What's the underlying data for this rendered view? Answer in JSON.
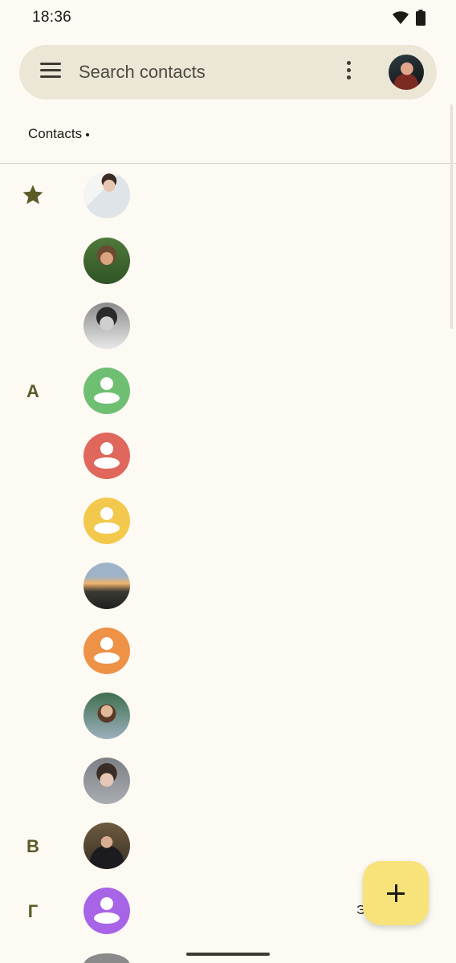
{
  "status_bar": {
    "time": "18:36",
    "icons": [
      "wifi-icon",
      "battery-icon"
    ]
  },
  "search": {
    "placeholder": "Search contacts"
  },
  "filter": {
    "label": "Contacts"
  },
  "sections": [
    "★",
    "А",
    "В",
    "Г"
  ],
  "contacts": [
    {
      "section": "favorites",
      "avatar": "photo"
    },
    {
      "section": "",
      "avatar": "photo"
    },
    {
      "section": "",
      "avatar": "photo"
    },
    {
      "section": "А",
      "avatar": "placeholder",
      "color": "#6fbf73"
    },
    {
      "section": "",
      "avatar": "placeholder",
      "color": "#e0675c"
    },
    {
      "section": "",
      "avatar": "placeholder",
      "color": "#f2c94c"
    },
    {
      "section": "",
      "avatar": "photo"
    },
    {
      "section": "",
      "avatar": "placeholder",
      "color": "#ee9248"
    },
    {
      "section": "",
      "avatar": "photo"
    },
    {
      "section": "",
      "avatar": "photo"
    },
    {
      "section": "В",
      "avatar": "photo"
    },
    {
      "section": "Г",
      "avatar": "placeholder",
      "color": "#a864e6"
    }
  ],
  "colors": {
    "background": "#fdfaf4",
    "search_bar": "#ece6d6",
    "section_letter": "#5c5a26",
    "fab": "#f7e37a"
  },
  "fab": {
    "icon": "plus-icon"
  },
  "partial_text": "ЭЗ"
}
